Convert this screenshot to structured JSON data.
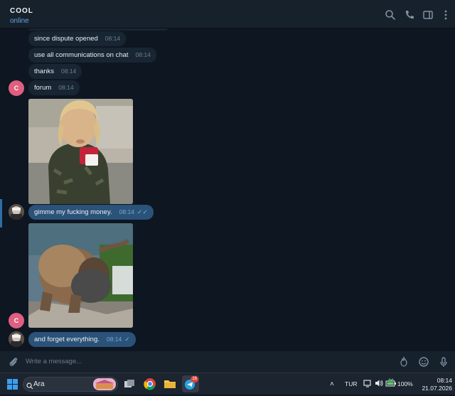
{
  "header": {
    "title": "COOL",
    "status": "online"
  },
  "messages": [
    {
      "text": "since dispute opened",
      "time": "08:14"
    },
    {
      "text": "use all communications on chat",
      "time": "08:14"
    },
    {
      "text": "thanks",
      "time": "08:14"
    },
    {
      "text": "forum",
      "time": "08:14"
    },
    {
      "text": "gimme my fucking money.",
      "time": "08:14"
    },
    {
      "text": "and forget everything.",
      "time": "08:14"
    }
  ],
  "avatar_letter": "C",
  "composer": {
    "placeholder": "Write a message..."
  },
  "taskbar": {
    "search_text": "Ara",
    "telegram_badge": "16",
    "language": "TUR",
    "battery": "100%",
    "time": "08:14",
    "date": "21.07.2026"
  },
  "colors": {
    "background": "#0e1621",
    "header": "#17212b",
    "incoming": "#182533",
    "outgoing": "#2b5278",
    "accent": "#5fa8e8",
    "avatar": "#e05f7f"
  }
}
